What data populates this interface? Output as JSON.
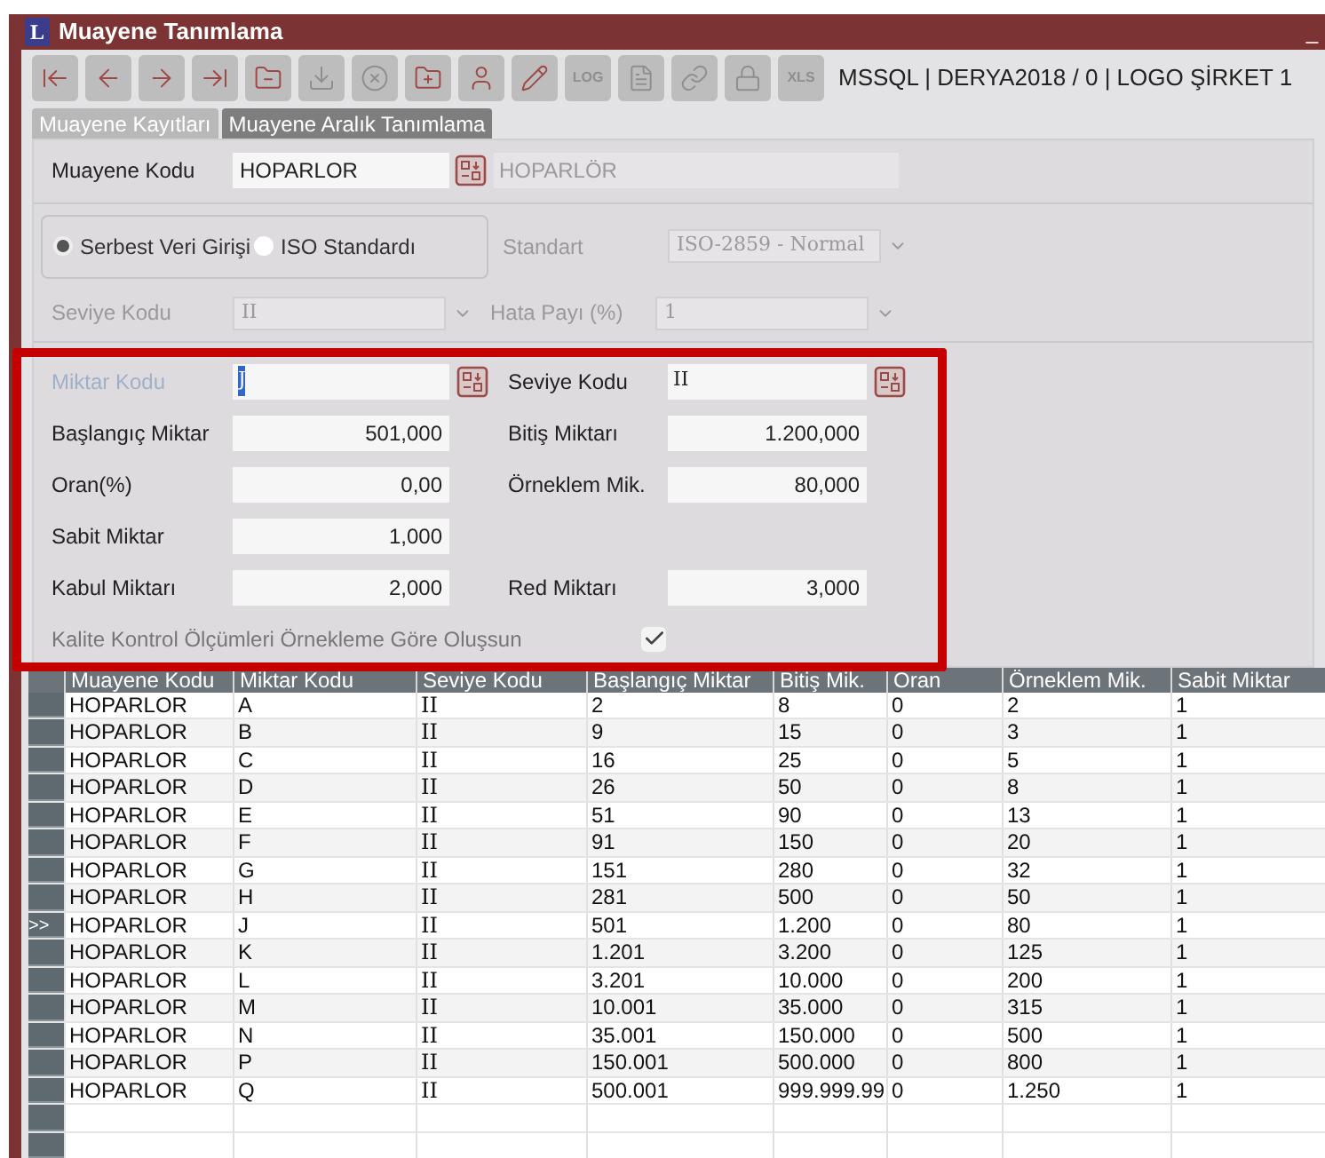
{
  "window": {
    "logo": "L",
    "title": "Muayene Tanımlama",
    "minimize": "_"
  },
  "toolbar": [
    {
      "kind": "icon",
      "disabled": false
    },
    {
      "kind": "icon",
      "disabled": false
    },
    {
      "kind": "icon",
      "disabled": false
    },
    {
      "kind": "icon",
      "disabled": false
    },
    {
      "kind": "icon",
      "disabled": false
    },
    {
      "kind": "icon",
      "disabled": true
    },
    {
      "kind": "icon",
      "disabled": true
    },
    {
      "kind": "icon",
      "disabled": false
    },
    {
      "kind": "icon",
      "disabled": false
    },
    {
      "kind": "icon",
      "disabled": false
    },
    {
      "kind": "text",
      "label": "LOG",
      "disabled": true
    },
    {
      "kind": "icon",
      "disabled": true
    },
    {
      "kind": "icon",
      "disabled": true
    },
    {
      "kind": "icon",
      "disabled": true
    },
    {
      "kind": "text",
      "label": "XLS",
      "disabled": true
    }
  ],
  "connection": "MSSQL | DERYA2018 / 0 | LOGO ŞİRKET 1",
  "tabs": [
    {
      "label": "Muayene Kayıtları",
      "selected": false
    },
    {
      "label": "Muayene Aralık Tanımlama",
      "selected": true
    }
  ],
  "header": {
    "code_label": "Muayene Kodu",
    "code_value": "HOPARLOR",
    "description": "HOPARLÖR"
  },
  "mode": {
    "options": [
      {
        "label": "Serbest Veri Girişi",
        "selected": true
      },
      {
        "label": "ISO Standardı",
        "selected": false
      }
    ],
    "standard": {
      "label": "Standart",
      "value": "ISO-2859 - Normal",
      "disabled": true
    },
    "level": {
      "label": "Seviye Kodu",
      "value": "II",
      "disabled": true
    },
    "error": {
      "label": "Hata Payı (%)",
      "value": "1",
      "disabled": true
    }
  },
  "range_form": {
    "rows": [
      [
        {
          "kind": "lookup",
          "label": "Miktar Kodu",
          "value": "J",
          "dimmed": true,
          "highlighted": true
        },
        {
          "kind": "lookup",
          "label": "Seviye Kodu",
          "value": "II",
          "dimmed": false,
          "highlighted": false
        }
      ],
      [
        {
          "kind": "number",
          "label": "Başlangıç Miktar",
          "value": "501,000"
        },
        {
          "kind": "number",
          "label": "Bitiş Miktarı",
          "value": "1.200,000"
        }
      ],
      [
        {
          "kind": "number",
          "label": "Oran(%)",
          "value": "0,00"
        },
        {
          "kind": "number",
          "label": "Örneklem Mik.",
          "value": "80,000"
        }
      ],
      [
        {
          "kind": "number",
          "label": "Sabit Miktar",
          "value": "1,000"
        }
      ],
      [
        {
          "kind": "number",
          "label": "Kabul Miktarı",
          "value": "2,000"
        },
        {
          "kind": "number",
          "label": "Red Miktarı",
          "value": "3,000"
        }
      ]
    ],
    "checkbox": {
      "label": "Kalite Kontrol Ölçümleri Örnekleme Göre Oluşsun",
      "checked": true
    }
  },
  "table": {
    "columns": [
      "Muayene Kodu",
      "Miktar Kodu",
      "Seviye Kodu",
      "Başlangıç Miktar",
      "Bitiş Mik.",
      "Oran",
      "Örneklem Mik.",
      "Sabit Miktar"
    ],
    "current_marker": ">>",
    "rows": [
      {
        "selected": false,
        "cells": [
          "HOPARLOR",
          "A",
          "II",
          "2",
          "8",
          "0",
          "2",
          "1"
        ]
      },
      {
        "selected": false,
        "cells": [
          "HOPARLOR",
          "B",
          "II",
          "9",
          "15",
          "0",
          "3",
          "1"
        ]
      },
      {
        "selected": false,
        "cells": [
          "HOPARLOR",
          "C",
          "II",
          "16",
          "25",
          "0",
          "5",
          "1"
        ]
      },
      {
        "selected": false,
        "cells": [
          "HOPARLOR",
          "D",
          "II",
          "26",
          "50",
          "0",
          "8",
          "1"
        ]
      },
      {
        "selected": false,
        "cells": [
          "HOPARLOR",
          "E",
          "II",
          "51",
          "90",
          "0",
          "13",
          "1"
        ]
      },
      {
        "selected": false,
        "cells": [
          "HOPARLOR",
          "F",
          "II",
          "91",
          "150",
          "0",
          "20",
          "1"
        ]
      },
      {
        "selected": false,
        "cells": [
          "HOPARLOR",
          "G",
          "II",
          "151",
          "280",
          "0",
          "32",
          "1"
        ]
      },
      {
        "selected": false,
        "cells": [
          "HOPARLOR",
          "H",
          "II",
          "281",
          "500",
          "0",
          "50",
          "1"
        ]
      },
      {
        "selected": true,
        "cells": [
          "HOPARLOR",
          "J",
          "II",
          "501",
          "1.200",
          "0",
          "80",
          "1"
        ]
      },
      {
        "selected": false,
        "cells": [
          "HOPARLOR",
          "K",
          "II",
          "1.201",
          "3.200",
          "0",
          "125",
          "1"
        ]
      },
      {
        "selected": false,
        "cells": [
          "HOPARLOR",
          "L",
          "II",
          "3.201",
          "10.000",
          "0",
          "200",
          "1"
        ]
      },
      {
        "selected": false,
        "cells": [
          "HOPARLOR",
          "M",
          "II",
          "10.001",
          "35.000",
          "0",
          "315",
          "1"
        ]
      },
      {
        "selected": false,
        "cells": [
          "HOPARLOR",
          "N",
          "II",
          "35.001",
          "150.000",
          "0",
          "500",
          "1"
        ]
      },
      {
        "selected": false,
        "cells": [
          "HOPARLOR",
          "P",
          "II",
          "150.001",
          "500.000",
          "0",
          "800",
          "1"
        ]
      },
      {
        "selected": false,
        "cells": [
          "HOPARLOR",
          "Q",
          "II",
          "500.001",
          "999.999.99",
          "0",
          "1.250",
          "1"
        ]
      }
    ]
  }
}
